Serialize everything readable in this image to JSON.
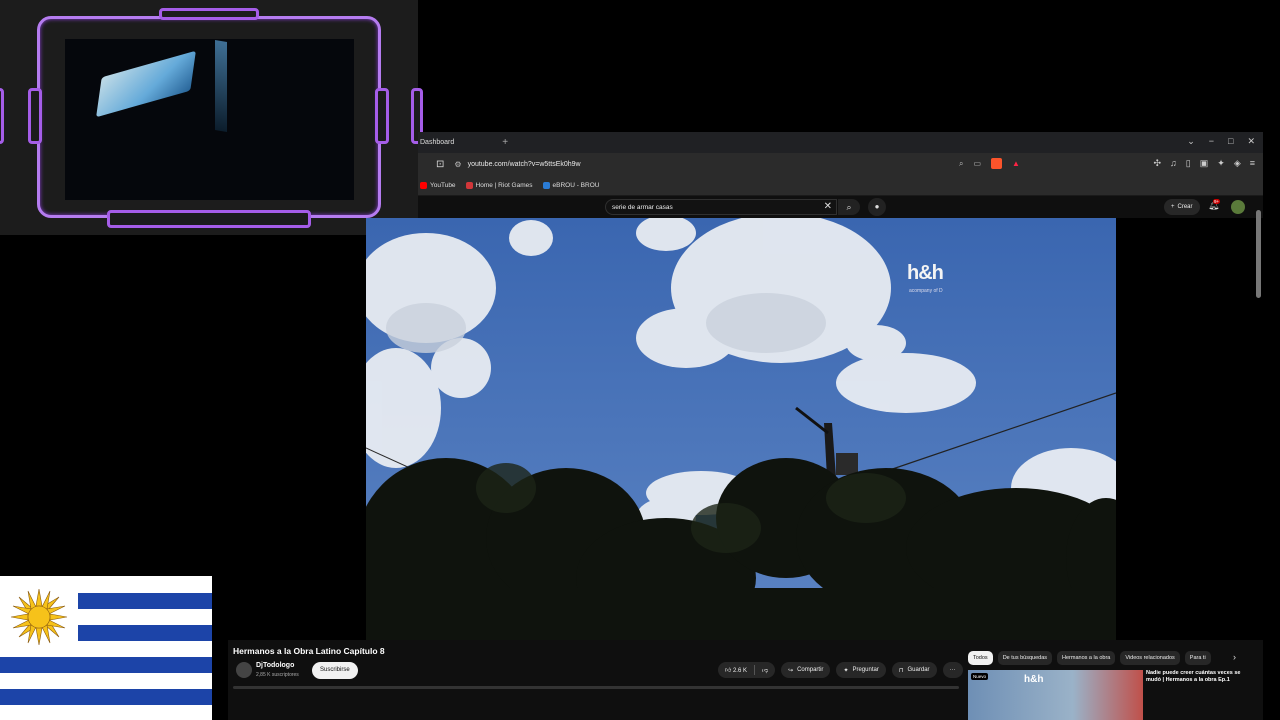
{
  "browser": {
    "tab_title": "Dashboard",
    "url": "youtube.com/watch?v=w5ttsEk0h9w",
    "bookmarks": [
      {
        "label": "YouTube",
        "color": "#ff0000"
      },
      {
        "label": "Home | Riot Games",
        "color": "#d13639"
      },
      {
        "label": "eBROU - BROU",
        "color": "#2a7bd4"
      }
    ],
    "icons": {
      "new_tab": "+",
      "minimize": "−",
      "maximize": "□",
      "close": "✕",
      "dropdown": "⌄"
    }
  },
  "youtube": {
    "search_query": "serie de armar casas",
    "create_label": "Crear",
    "notification_count": "9+",
    "watermark": "h&h",
    "watermark_sub": "acompany of D",
    "video_title": "Hermanos a la Obra Latino Capítulo 8",
    "channel_name": "DjTodologo",
    "channel_subs": "2,85 K suscriptores",
    "subscribe_label": "Suscribirse",
    "like_count": "2.6 K",
    "share_label": "Compartir",
    "ask_label": "Preguntar",
    "save_label": "Guardar",
    "more_label": "···",
    "chips": [
      "Todos",
      "De tus búsquedas",
      "Hermanos a la obra",
      "Videos relacionados",
      "Para ti"
    ],
    "reco": {
      "badge": "Nuevo",
      "logo": "h&h",
      "title": "Nadie puede creer cuántas veces se mudó | Hermanos a la obra Ep.1"
    }
  },
  "colors": {
    "frame_purple": "#a55de8",
    "flag_blue": "#1c44a8",
    "sun_yellow": "#f6c21a"
  }
}
